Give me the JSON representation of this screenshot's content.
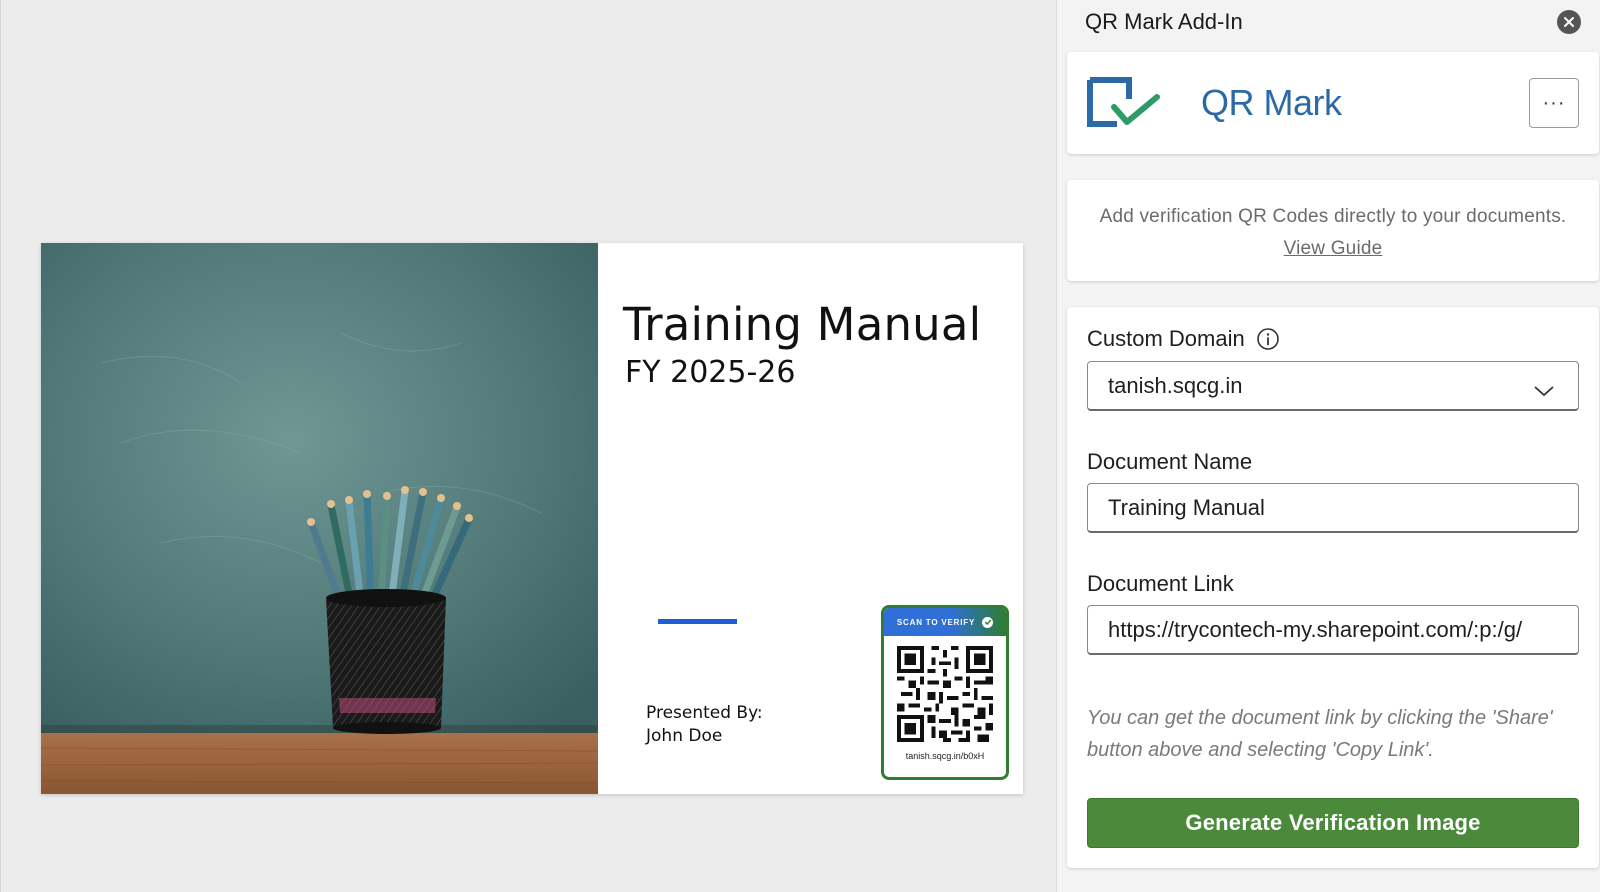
{
  "slide": {
    "title": "Training Manual",
    "subtitle": "FY 2025-26",
    "presented_by_label": "Presented By:",
    "presenter": "John Doe",
    "qr_badge": {
      "header": "SCAN TO VERIFY",
      "url": "tanish.sqcg.in/b0xH"
    }
  },
  "pane": {
    "title": "QR Mark Add-In",
    "brand": {
      "name": "QR Mark",
      "more_label": "···"
    },
    "intro": {
      "text": "Add verification QR Codes directly to your documents.",
      "link": "View Guide"
    },
    "form": {
      "custom_domain": {
        "label": "Custom Domain",
        "value": "tanish.sqcg.in"
      },
      "document_name": {
        "label": "Document Name",
        "value": "Training Manual"
      },
      "document_link": {
        "label": "Document Link",
        "value": "https://trycontech-my.sharepoint.com/:p:/g/"
      },
      "hint": "You can get the document link by clicking the 'Share' button above and selecting 'Copy Link'.",
      "generate_label": "Generate Verification Image"
    }
  },
  "colors": {
    "brand_blue": "#2b6aa6",
    "brand_green": "#4a8a3a",
    "slide_accent": "#1f5fd6"
  },
  "icons": {
    "close": "close-icon",
    "info": "info-icon",
    "chevron": "chevron-down-icon",
    "logo": "qr-mark-logo-icon",
    "check": "check-circle-icon"
  }
}
